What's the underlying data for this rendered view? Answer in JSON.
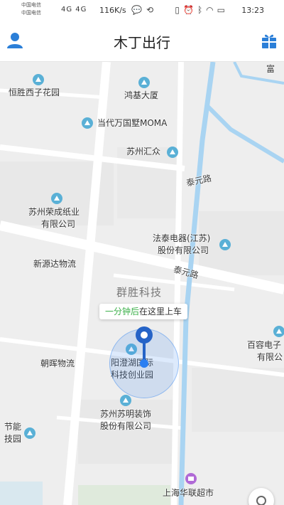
{
  "status_bar": {
    "carrier_1": "中国电信",
    "carrier_2": "中国电信",
    "signal": "4G 4G",
    "net_speed": "116K/s",
    "time": "13:23",
    "icons": [
      "chat-bubble-icon",
      "sync-icon",
      "bluetooth-icon",
      "wifi-icon",
      "battery-icon",
      "alarm-icon",
      "vibrate-icon"
    ]
  },
  "header": {
    "title": "木丁出行",
    "left_icon": "user-icon",
    "right_icon": "gift-icon",
    "accent_color": "#2b7fd8"
  },
  "map": {
    "pois": {
      "hengsheng": "恒胜西子花园",
      "hongji": "鸿基大厦",
      "dangdai": "当代万国墅MOMA",
      "suzhou_huizhong": "苏州汇众",
      "suzhou_rongcheng_1": "苏州荣成纸业",
      "suzhou_rongcheng_2": "有限公司",
      "fatai_1": "法泰电器(江苏)",
      "fatai_2": "股份有限公司",
      "xinyuanda": "新源达物流",
      "chaohui": "朝晖物流",
      "yangcheng_1": "阳澄湖国际",
      "yangcheng_2": "科技创业园",
      "suming_1": "苏州苏明装饰",
      "suming_2": "股份有限公司",
      "jieneng_1": "节能",
      "jieneng_2": "技园",
      "shanghai_hualian": "上海华联超市",
      "bairong_1": "百容电子",
      "bairong_2": "有限公",
      "partial_top_right": "富"
    },
    "roads": {
      "taiyuan_1": "泰元路",
      "taiyuan_2": "泰元路"
    },
    "area_label": "群胜科技",
    "pickup": {
      "time": "一分钟后",
      "text": "在这里上车"
    }
  }
}
